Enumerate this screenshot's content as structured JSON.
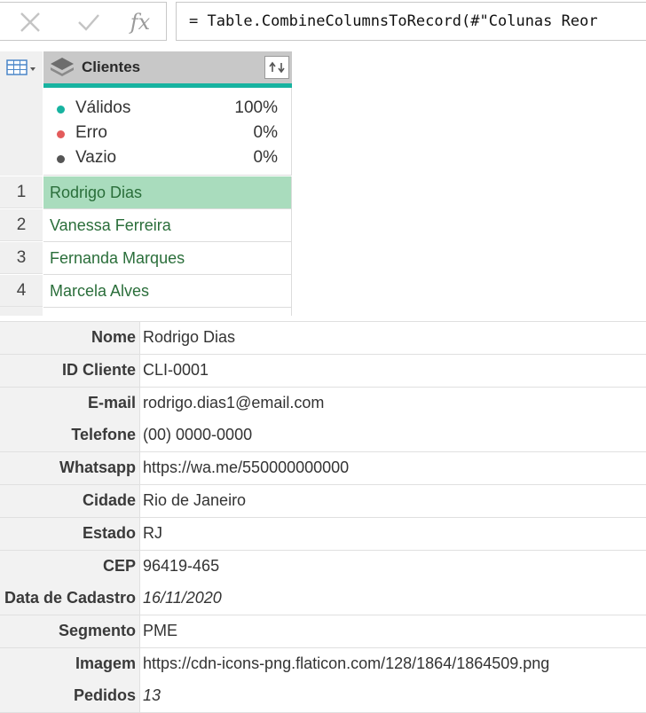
{
  "formula_bar": {
    "cancel_icon": "x-icon",
    "confirm_icon": "check-icon",
    "fx_label": "fx",
    "formula": "= Table.CombineColumnsToRecord(#\"Colunas Reor"
  },
  "grid": {
    "column": {
      "title": "Clientes",
      "type_icon": "record-column-icon",
      "expand_icon": "expand-record-icon"
    },
    "quality": [
      {
        "label": "Válidos",
        "value": "100%",
        "color": "#17b3a0"
      },
      {
        "label": "Erro",
        "value": "0%",
        "color": "#e35b5b"
      },
      {
        "label": "Vazio",
        "value": "0%",
        "color": "#555555"
      }
    ],
    "rows": [
      {
        "num": "1",
        "value": "Rodrigo Dias",
        "selected": true
      },
      {
        "num": "2",
        "value": "Vanessa Ferreira",
        "selected": false
      },
      {
        "num": "3",
        "value": "Fernanda Marques",
        "selected": false
      },
      {
        "num": "4",
        "value": "Marcela Alves",
        "selected": false
      }
    ]
  },
  "record": [
    {
      "label": "Nome",
      "value": "Rodrigo Dias",
      "italic": false
    },
    {
      "label": "ID Cliente",
      "value": "CLI-0001",
      "italic": false
    },
    {
      "label": "E-mail",
      "value": "rodrigo.dias1@email.com",
      "italic": false
    },
    {
      "label": "Telefone",
      "value": "(00) 0000-0000",
      "italic": false
    },
    {
      "label": "Whatsapp",
      "value": "https://wa.me/550000000000",
      "italic": false
    },
    {
      "label": "Cidade",
      "value": "Rio de Janeiro",
      "italic": false
    },
    {
      "label": "Estado",
      "value": "RJ",
      "italic": false
    },
    {
      "label": "CEP",
      "value": "96419-465",
      "italic": false
    },
    {
      "label": "Data de Cadastro",
      "value": "16/11/2020",
      "italic": true
    },
    {
      "label": "Segmento",
      "value": "PME",
      "italic": false
    },
    {
      "label": "Imagem",
      "value": "https://cdn-icons-png.flaticon.com/128/1864/1864509.png",
      "italic": false
    },
    {
      "label": "Pedidos",
      "value": "13",
      "italic": true
    }
  ]
}
